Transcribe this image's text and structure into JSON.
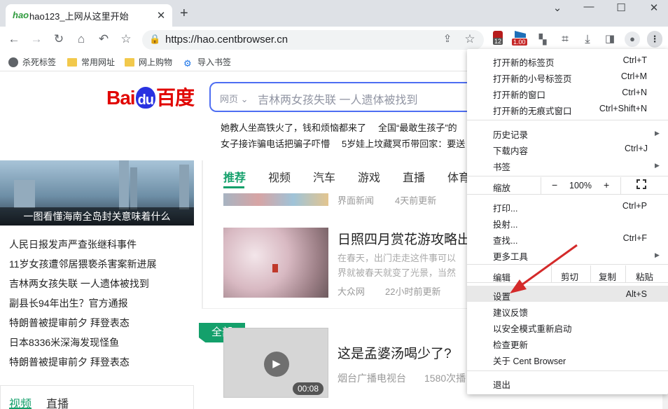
{
  "tab": {
    "title": "hao123_上网从这里开始",
    "favicon": "hao",
    "close": "✕",
    "new": "+"
  },
  "window": {
    "min": "⌄",
    "minimize": "—",
    "maximize": "☐",
    "close": "✕"
  },
  "address": {
    "url": "https://hao.centbrowser.cn"
  },
  "extensions": {
    "badge1": "12",
    "badge2": "1.00"
  },
  "bookmarks": [
    "杀死标签",
    "常用网址",
    "网上购物",
    "导入书签"
  ],
  "baidu": {
    "logo_left": "Bai",
    "logo_du": "du",
    "logo_right": "百度",
    "search_type": "网页",
    "placeholder": "吉林两女孩失联 一人遗体被找到"
  },
  "hot": [
    "她教人坐高铁火了，钱和烦恼都来了",
    "全国“最敢生孩子”的",
    "女子接诈骗电话把骗子吓懵",
    "5岁娃上坟藏冥币带回家：要送"
  ],
  "left": {
    "hero_caption": "一图看懂海南全岛封关意味着什么",
    "news": [
      "人民日报发声严查张继科事件",
      "11岁女孩遭邻居猥亵杀害案新进展",
      "吉林两女孩失联 一人遗体被找到",
      "副县长94年出生？官方通报",
      "特朗普被提审前夕 拜登表态",
      "日本8336米深海发现怪鱼",
      "特朗普被提审前夕 拜登表态"
    ],
    "tabs": [
      "视频",
      "直播"
    ]
  },
  "feed": {
    "tabs": [
      "推荐",
      "视频",
      "汽车",
      "游戏",
      "直播",
      "体育"
    ],
    "item0": {
      "source": "界面新闻",
      "time": "4天前更新"
    },
    "item1": {
      "title": "日照四月赏花游攻略出炉",
      "desc1": "在春天，出门走走这件事可以",
      "desc2": "界就被春天就变了光景，当然",
      "source": "大众网",
      "time": "22小时前更新"
    },
    "all": "全部",
    "item2": {
      "title": "这是孟婆汤喝少了?",
      "source": "烟台广播电视台",
      "time": "1580次播",
      "duration": "00:08"
    }
  },
  "menu": {
    "items": [
      {
        "label": "打开新的标签页",
        "sc": "Ctrl+T"
      },
      {
        "label": "打开新的小号标签页",
        "sc": "Ctrl+M"
      },
      {
        "label": "打开新的窗口",
        "sc": "Ctrl+N"
      },
      {
        "label": "打开新的无痕式窗口",
        "sc": "Ctrl+Shift+N"
      },
      {
        "label": "历史记录",
        "sc": ""
      },
      {
        "label": "下载内容",
        "sc": "Ctrl+J"
      },
      {
        "label": "书签",
        "sc": ""
      },
      {
        "label": "打印...",
        "sc": "Ctrl+P"
      },
      {
        "label": "投射...",
        "sc": ""
      },
      {
        "label": "查找...",
        "sc": "Ctrl+F"
      },
      {
        "label": "更多工具",
        "sc": ""
      },
      {
        "label": "设置",
        "sc": "Alt+S"
      },
      {
        "label": "建议反馈",
        "sc": ""
      },
      {
        "label": "以安全模式重新启动",
        "sc": ""
      },
      {
        "label": "检查更新",
        "sc": ""
      },
      {
        "label": "关于 Cent Browser",
        "sc": ""
      },
      {
        "label": "退出",
        "sc": ""
      }
    ],
    "zoom": {
      "label": "缩放",
      "minus": "−",
      "value": "100%",
      "plus": "+"
    },
    "edit": {
      "label": "编辑",
      "cut": "剪切",
      "copy": "复制",
      "paste": "粘贴"
    }
  },
  "colors": {
    "accent": "#14a06b",
    "baidu_blue": "#2932e1",
    "baidu_red": "#e10602",
    "arrow": "#d42a2a"
  }
}
